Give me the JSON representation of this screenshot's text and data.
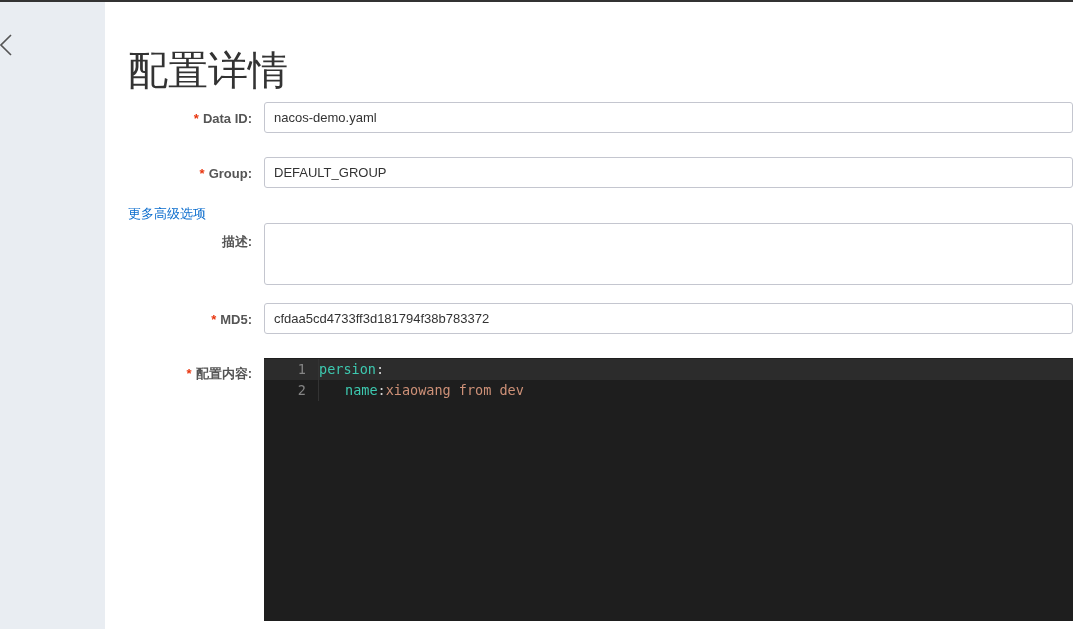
{
  "page": {
    "title": "配置详情"
  },
  "fields": [
    {
      "mark": "*",
      "label": "Data ID:",
      "kind": "input",
      "value": "nacos-demo.yaml"
    },
    {
      "mark": "*",
      "label": "Group:",
      "kind": "input",
      "value": "DEFAULT_GROUP"
    },
    {
      "kind": "link",
      "label": "更多高级选项"
    },
    {
      "label": "描述:",
      "kind": "textarea"
    },
    {
      "mark": "*",
      "label": "MD5:",
      "kind": "input",
      "value": "cfdaa5cd4733ff3d181794f38b783372"
    },
    {
      "mark": "*",
      "label": "配置内容:",
      "kind": "editor"
    }
  ],
  "code_editor": {
    "lines": [
      {
        "number": "1",
        "key": "persion",
        "colon": ":",
        "active": true,
        "indent": false
      },
      {
        "number": "2",
        "key": "name",
        "colon": ":",
        "value": "xiaowang from dev",
        "indent": true,
        "active": false
      }
    ]
  }
}
